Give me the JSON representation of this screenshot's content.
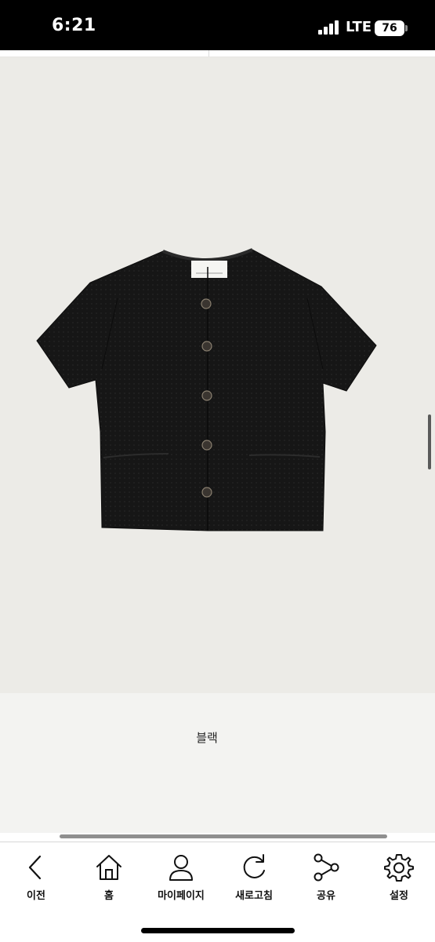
{
  "status_bar": {
    "time": "6:21",
    "network": "LTE",
    "battery_level": "76"
  },
  "product": {
    "color_caption": "블랙",
    "image_icon": "black-short-sleeve-knit-cardigan-image"
  },
  "toolbar": {
    "items": [
      {
        "label": "이전",
        "icon": "back-chevron-icon"
      },
      {
        "label": "홈",
        "icon": "home-icon"
      },
      {
        "label": "마이페이지",
        "icon": "person-icon"
      },
      {
        "label": "새로고침",
        "icon": "refresh-icon"
      },
      {
        "label": "공유",
        "icon": "share-icon"
      },
      {
        "label": "설정",
        "icon": "gear-icon"
      }
    ]
  },
  "colors": {
    "status_bar_bg": "#000000",
    "image_bg": "#ecebe7",
    "garment": "#141414",
    "toolbar_bg": "#ffffff"
  }
}
